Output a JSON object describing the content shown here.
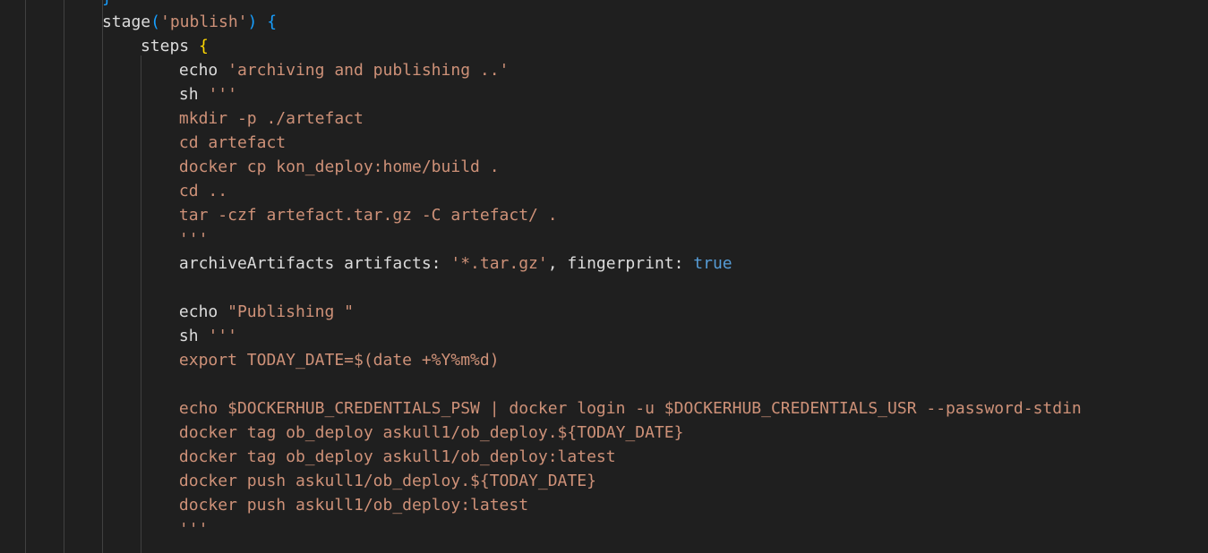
{
  "editor": {
    "language": "groovy",
    "colors": {
      "background": "#1f1f1f",
      "indent_guide": "#404040",
      "identifier": "#dcdcdc",
      "string": "#ce9178",
      "bracket_gold": "#ffd700",
      "bracket_blue": "#179fff",
      "keyword": "#569cd6"
    },
    "lines": [
      {
        "indent": 2,
        "tokens": [
          {
            "t": "}",
            "c": "t-paren"
          }
        ]
      },
      {
        "indent": 2,
        "tokens": [
          {
            "t": "stage",
            "c": "t-ident"
          },
          {
            "t": "(",
            "c": "t-paren"
          },
          {
            "t": "'publish'",
            "c": "t-str"
          },
          {
            "t": ")",
            "c": "t-paren"
          },
          {
            "t": " ",
            "c": "t-ident"
          },
          {
            "t": "{",
            "c": "t-paren"
          }
        ]
      },
      {
        "indent": 3,
        "tokens": [
          {
            "t": "steps ",
            "c": "t-ident"
          },
          {
            "t": "{",
            "c": "t-brace"
          }
        ]
      },
      {
        "indent": 4,
        "tokens": [
          {
            "t": "echo ",
            "c": "t-ident"
          },
          {
            "t": "'archiving and publishing ..'",
            "c": "t-str"
          }
        ]
      },
      {
        "indent": 4,
        "tokens": [
          {
            "t": "sh ",
            "c": "t-ident"
          },
          {
            "t": "'''",
            "c": "t-str"
          }
        ]
      },
      {
        "indent": 4,
        "tokens": [
          {
            "t": "mkdir -p ./artefact",
            "c": "t-str"
          }
        ]
      },
      {
        "indent": 4,
        "tokens": [
          {
            "t": "cd artefact",
            "c": "t-str"
          }
        ]
      },
      {
        "indent": 4,
        "tokens": [
          {
            "t": "docker cp kon_deploy:home/build .",
            "c": "t-str"
          }
        ]
      },
      {
        "indent": 4,
        "tokens": [
          {
            "t": "cd ..",
            "c": "t-str"
          }
        ]
      },
      {
        "indent": 4,
        "tokens": [
          {
            "t": "tar -czf artefact.tar.gz -C artefact/ .",
            "c": "t-str"
          }
        ]
      },
      {
        "indent": 4,
        "tokens": [
          {
            "t": "'''",
            "c": "t-str"
          }
        ]
      },
      {
        "indent": 4,
        "tokens": [
          {
            "t": "archiveArtifacts artifacts: ",
            "c": "t-ident"
          },
          {
            "t": "'*.tar.gz'",
            "c": "t-str"
          },
          {
            "t": ", fingerprint: ",
            "c": "t-ident"
          },
          {
            "t": "true",
            "c": "t-kw"
          }
        ]
      },
      {
        "indent": 4,
        "tokens": []
      },
      {
        "indent": 4,
        "tokens": [
          {
            "t": "echo ",
            "c": "t-ident"
          },
          {
            "t": "\"Publishing \"",
            "c": "t-str"
          }
        ]
      },
      {
        "indent": 4,
        "tokens": [
          {
            "t": "sh ",
            "c": "t-ident"
          },
          {
            "t": "'''",
            "c": "t-str"
          }
        ]
      },
      {
        "indent": 4,
        "tokens": [
          {
            "t": "export TODAY_DATE=$(date +%Y%m%d)",
            "c": "t-str"
          }
        ]
      },
      {
        "indent": 4,
        "tokens": []
      },
      {
        "indent": 4,
        "tokens": [
          {
            "t": "echo $DOCKERHUB_CREDENTIALS_PSW | docker login -u $DOCKERHUB_CREDENTIALS_USR --password-stdin",
            "c": "t-str"
          }
        ]
      },
      {
        "indent": 4,
        "tokens": [
          {
            "t": "docker tag ob_deploy askull1/ob_deploy.${TODAY_DATE}",
            "c": "t-str"
          }
        ]
      },
      {
        "indent": 4,
        "tokens": [
          {
            "t": "docker tag ob_deploy askull1/ob_deploy:latest",
            "c": "t-str"
          }
        ]
      },
      {
        "indent": 4,
        "tokens": [
          {
            "t": "docker push askull1/ob_deploy.${TODAY_DATE}",
            "c": "t-str"
          }
        ]
      },
      {
        "indent": 4,
        "tokens": [
          {
            "t": "docker push askull1/ob_deploy:latest",
            "c": "t-str"
          }
        ]
      },
      {
        "indent": 4,
        "tokens": [
          {
            "t": "'''",
            "c": "t-str"
          }
        ]
      }
    ]
  }
}
